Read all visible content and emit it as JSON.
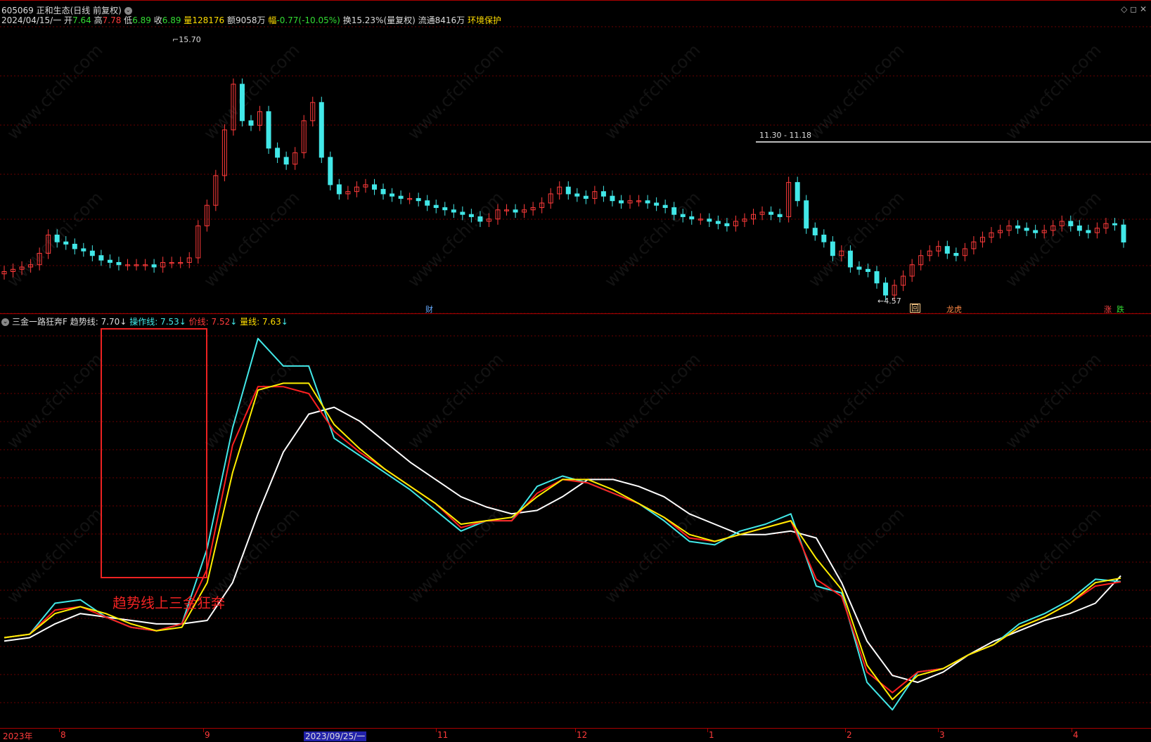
{
  "header": {
    "title": "605069 正和生态(日线 前复权)",
    "date_label": "2024/04/15/一",
    "open_label": "开",
    "open": "7.64",
    "high_label": "高",
    "high": "7.78",
    "low_label": "低",
    "low": "6.89",
    "close_label": "收",
    "close": "6.89",
    "vol_label": "量",
    "vol": "128176",
    "amount_label": "额",
    "amount": "9058万",
    "change_label": "幅",
    "change": "-0.77(-10.05%)",
    "turnover": "换15.23%(量复权)",
    "float_cap": "流通8416万",
    "tag": "环境保护",
    "win_ctrls": "◇ ◻ ✕"
  },
  "price_chart": {
    "high_marker": "15.70",
    "low_marker": "4.57",
    "range_marker": "11.30 - 11.18",
    "event_markers": [
      "财",
      "回",
      "龙虎",
      "涨",
      "跌"
    ]
  },
  "indicator": {
    "name": "三金一路狂奔F",
    "items": [
      {
        "label": "趋势线: 7.70",
        "arrow": "↓"
      },
      {
        "label": "操作线: 7.53",
        "arrow": "↓"
      },
      {
        "label": "价线: 7.52",
        "arrow": "↓"
      },
      {
        "label": "量线: 7.63",
        "arrow": "↓"
      }
    ],
    "annotation": "趋势线上三金狂奔"
  },
  "x_axis": {
    "labels": [
      "2023年",
      "8",
      "9",
      "2023/09/25/一",
      "11",
      "12",
      "1",
      "2",
      "3",
      "4"
    ]
  },
  "watermark": "www.cfchi.com",
  "colors": {
    "up": "#ff3b3b",
    "down": "#42e8e8",
    "trend": "#ffffff",
    "op": "#42e8e8",
    "price": "#ff2020",
    "vol": "#ffee00",
    "grid": "#7a0000"
  },
  "chart_data": {
    "type": "line",
    "title": "605069 正和生态(日线 前复权)",
    "series": [
      {
        "name": "趋势线",
        "values": [
          5.8,
          5.9,
          6.3,
          6.6,
          6.5,
          6.4,
          6.3,
          6.3,
          6.4,
          7.5,
          9.5,
          11.3,
          12.4,
          12.6,
          12.2,
          11.6,
          11.0,
          10.5,
          10.0,
          9.7,
          9.5,
          9.6,
          10.0,
          10.5,
          10.5,
          10.3,
          10.0,
          9.5,
          9.2,
          8.9,
          8.9,
          9.0,
          8.8,
          7.5,
          5.8,
          4.8,
          4.6,
          4.9,
          5.4,
          5.8,
          6.1,
          6.4,
          6.6,
          6.9,
          7.7
        ]
      },
      {
        "name": "操作线",
        "values": [
          5.9,
          6.0,
          6.9,
          7.0,
          6.5,
          6.2,
          6.1,
          6.3,
          8.5,
          12.0,
          14.6,
          13.8,
          13.8,
          11.7,
          11.2,
          10.7,
          10.2,
          9.6,
          9.0,
          9.3,
          9.3,
          10.3,
          10.6,
          10.4,
          10.1,
          9.8,
          9.3,
          8.7,
          8.6,
          9.0,
          9.2,
          9.5,
          7.4,
          7.2,
          4.6,
          3.8,
          4.9,
          5.0,
          5.4,
          5.7,
          6.3,
          6.6,
          7.0,
          7.6,
          7.53
        ]
      },
      {
        "name": "价线",
        "values": [
          5.9,
          6.0,
          6.7,
          6.8,
          6.5,
          6.2,
          6.1,
          6.3,
          7.9,
          11.5,
          13.2,
          13.2,
          13.0,
          11.9,
          11.3,
          10.8,
          10.3,
          9.8,
          9.1,
          9.3,
          9.3,
          10.1,
          10.5,
          10.4,
          10.1,
          9.8,
          9.4,
          8.8,
          8.7,
          8.9,
          9.1,
          9.3,
          7.6,
          7.1,
          4.9,
          4.3,
          4.9,
          5.0,
          5.4,
          5.7,
          6.2,
          6.5,
          6.9,
          7.4,
          7.52
        ]
      },
      {
        "name": "量线",
        "values": [
          5.9,
          6.0,
          6.6,
          6.8,
          6.6,
          6.3,
          6.1,
          6.2,
          7.5,
          10.7,
          13.1,
          13.3,
          13.3,
          12.1,
          11.4,
          10.8,
          10.3,
          9.8,
          9.2,
          9.3,
          9.4,
          10.0,
          10.5,
          10.5,
          10.2,
          9.8,
          9.4,
          8.9,
          8.7,
          8.9,
          9.1,
          9.3,
          8.2,
          7.3,
          5.1,
          4.1,
          4.8,
          5.0,
          5.4,
          5.7,
          6.2,
          6.5,
          6.9,
          7.5,
          7.63
        ]
      }
    ],
    "x_labels": [
      "2023年",
      "8",
      "9",
      "2023/09/25/一",
      "11",
      "12",
      "1",
      "2",
      "3",
      "4"
    ]
  }
}
